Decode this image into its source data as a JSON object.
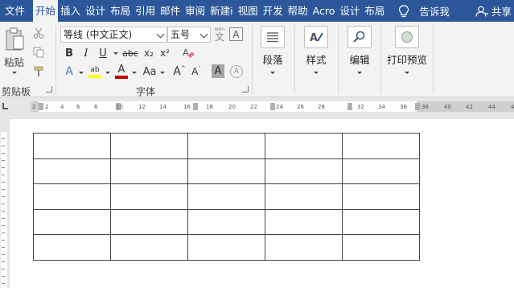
{
  "tabs": [
    {
      "label": "文件",
      "active": false
    },
    {
      "label": "开始",
      "active": true
    },
    {
      "label": "插入",
      "active": false
    },
    {
      "label": "设计",
      "active": false
    },
    {
      "label": "布局",
      "active": false
    },
    {
      "label": "引用",
      "active": false
    },
    {
      "label": "邮件",
      "active": false
    },
    {
      "label": "审阅",
      "active": false
    },
    {
      "label": "新建i",
      "active": false
    },
    {
      "label": "视图",
      "active": false
    },
    {
      "label": "开发",
      "active": false
    },
    {
      "label": "帮助",
      "active": false
    },
    {
      "label": "Acro",
      "active": false
    },
    {
      "label": "设计",
      "active": false
    },
    {
      "label": "布局",
      "active": false
    }
  ],
  "tell_me": "告诉我",
  "share": "共享",
  "clipboard": {
    "paste_label": "粘贴",
    "group_label": "剪贴板"
  },
  "font": {
    "font_name": "等线 (中文正文)",
    "font_size": "五号",
    "wen_label": "wén",
    "wen_char": "文",
    "A_label": "A",
    "group_label": "字体",
    "bold": "B",
    "italic": "I",
    "underline": "U",
    "strike": "abc",
    "subscript": "x₂",
    "superscript": "x²",
    "highlight": "ab",
    "font_color": "A",
    "change_case": "Aa",
    "grow": "A",
    "shrink": "A",
    "char_shading": "A",
    "effects": "A"
  },
  "paragraph": {
    "label": "段落"
  },
  "styles": {
    "label": "样式"
  },
  "editing": {
    "label": "编辑"
  },
  "print_preview": {
    "label": "打印预览"
  },
  "ruler": {
    "ticks": [
      "2",
      "2",
      "4",
      "6",
      "8",
      "10",
      "12",
      "14",
      "16",
      "18",
      "20",
      "22",
      "24",
      "26",
      "28",
      "32",
      "34",
      "36",
      "38",
      "40",
      "42",
      "44",
      "46"
    ]
  },
  "table": {
    "rows": 5,
    "cols": 5
  },
  "colors": {
    "titlebar": "#2b579a",
    "ribbon": "#f3f3f3",
    "highlight_yellow": "#ffff00",
    "font_red": "#c00000"
  }
}
